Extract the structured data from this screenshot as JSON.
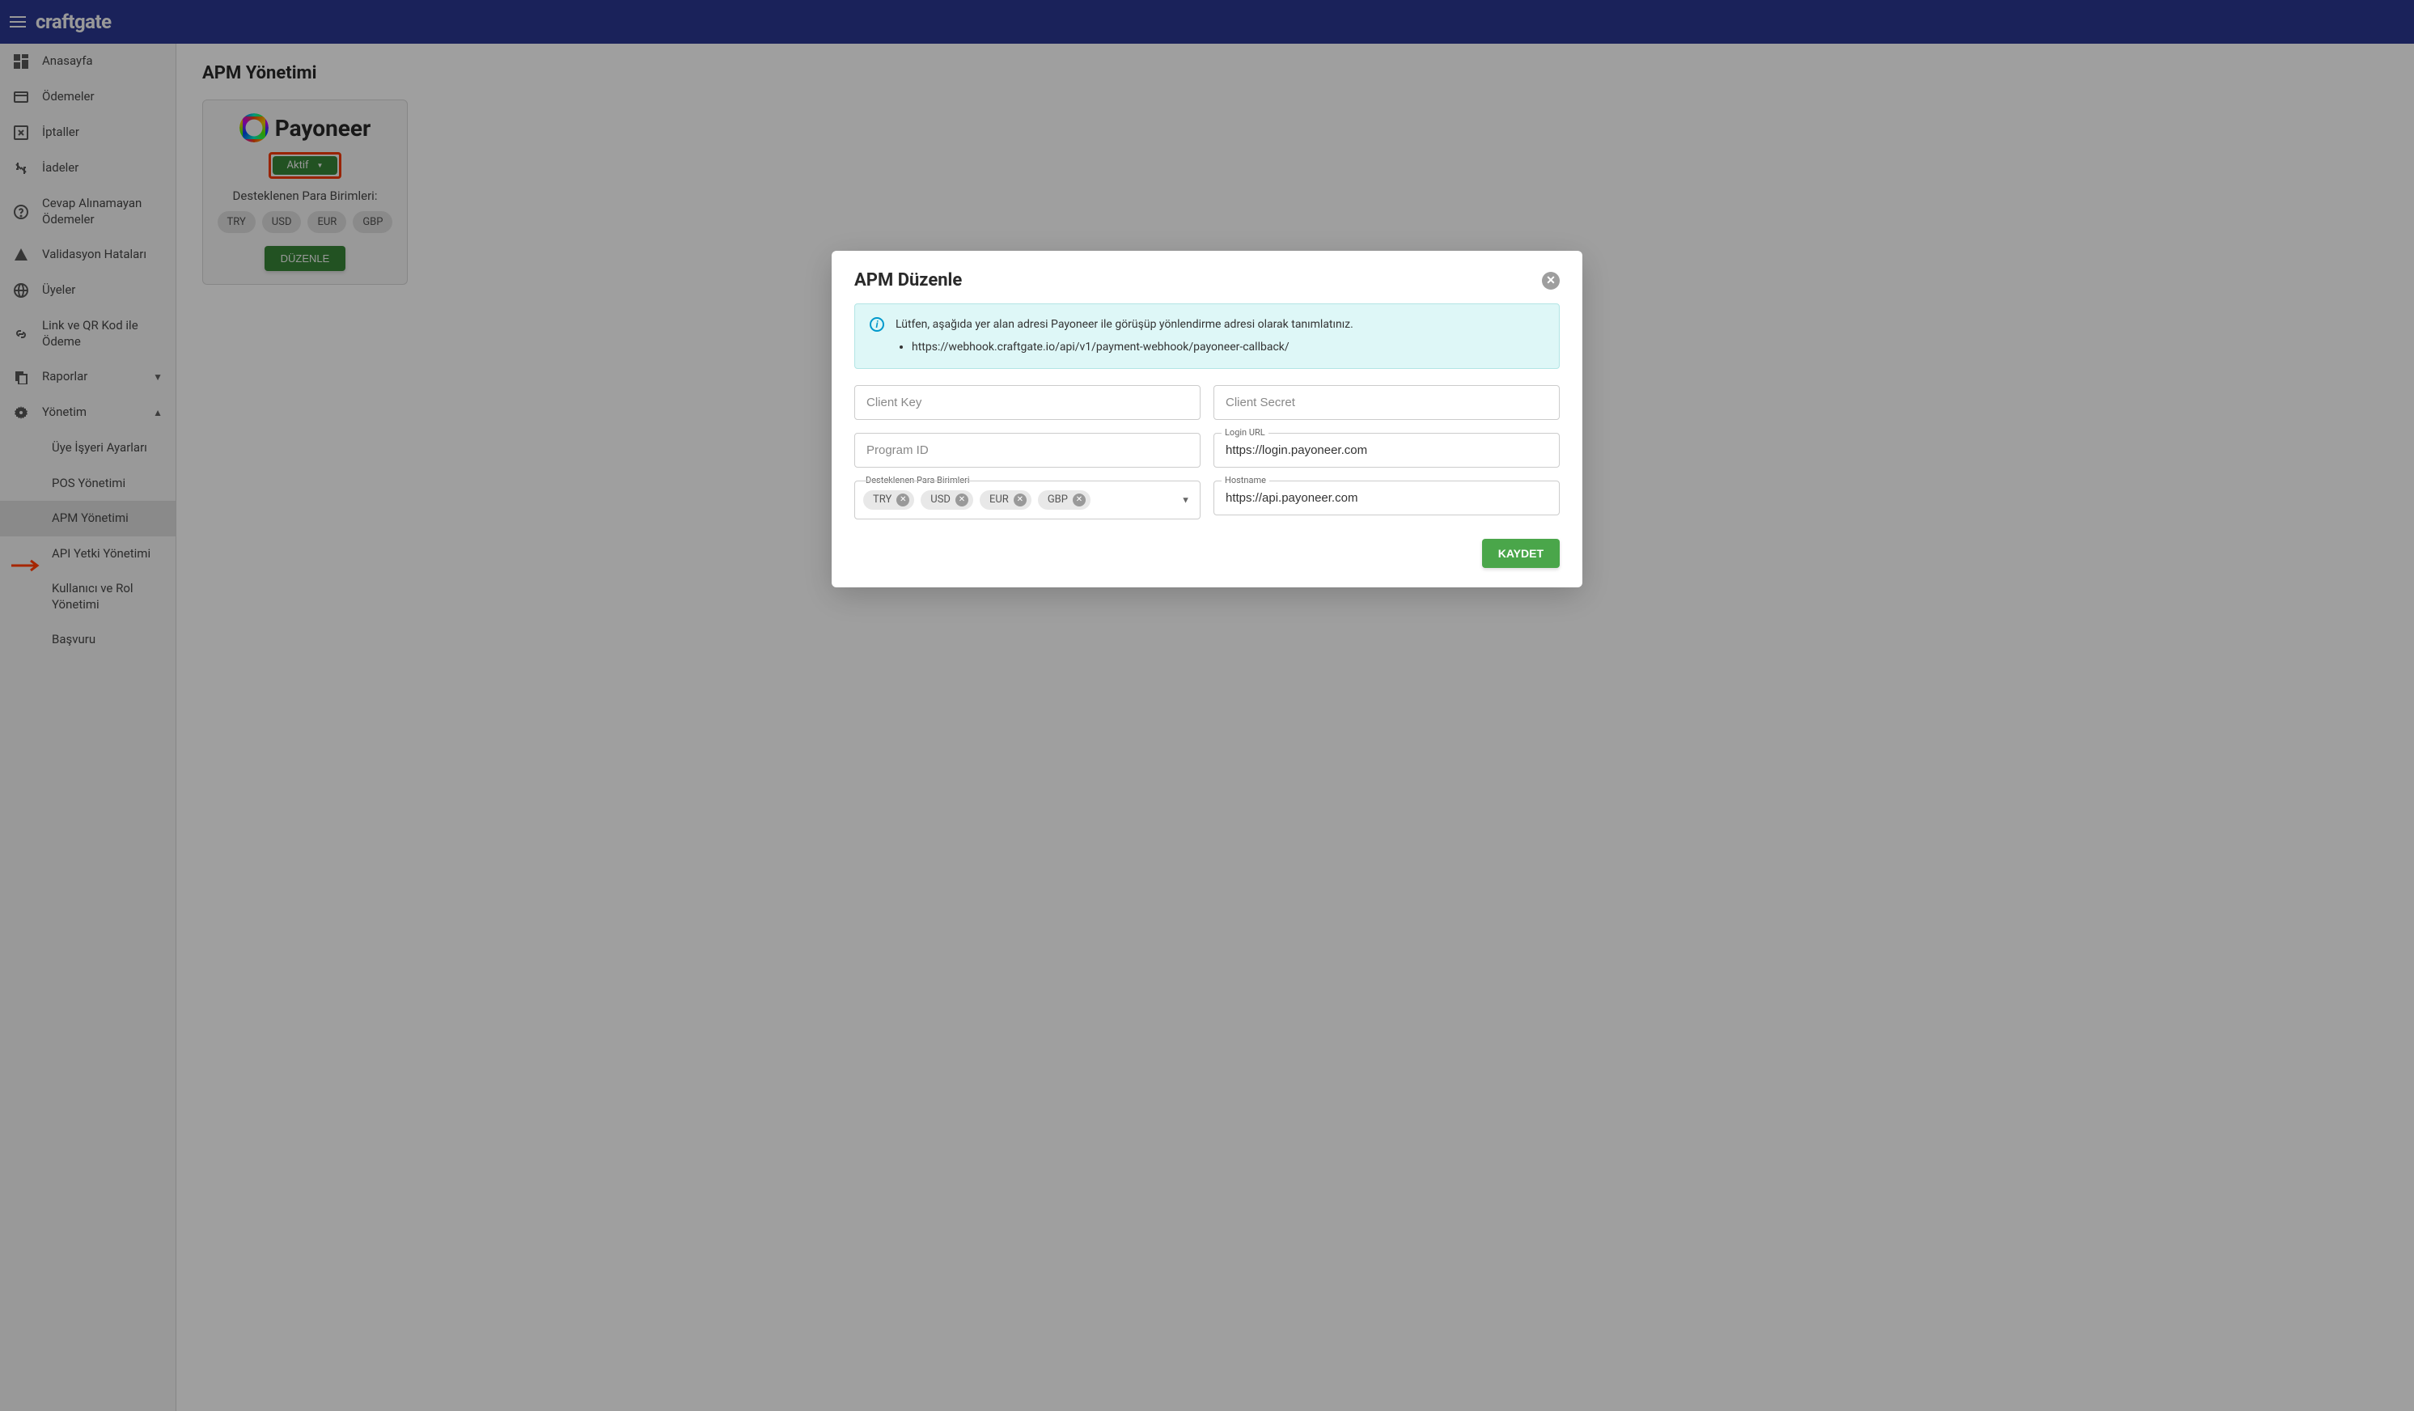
{
  "header": {
    "logo": "craftgate"
  },
  "sidebar": {
    "items": [
      {
        "label": "Anasayfa"
      },
      {
        "label": "Ödemeler"
      },
      {
        "label": "İptaller"
      },
      {
        "label": "İadeler"
      },
      {
        "label": "Cevap Alınamayan Ödemeler"
      },
      {
        "label": "Validasyon Hataları"
      },
      {
        "label": "Üyeler"
      },
      {
        "label": "Link ve QR Kod ile Ödeme"
      },
      {
        "label": "Raporlar"
      },
      {
        "label": "Yönetim"
      }
    ],
    "subitems": [
      {
        "label": "Üye İşyeri Ayarları"
      },
      {
        "label": "POS Yönetimi"
      },
      {
        "label": "APM Yönetimi"
      },
      {
        "label": "API Yetki Yönetimi"
      },
      {
        "label": "Kullanıcı ve Rol Yönetimi"
      },
      {
        "label": "Başvuru"
      }
    ]
  },
  "page": {
    "title": "APM Yönetimi"
  },
  "card": {
    "brand": "Payoneer",
    "status": "Aktif",
    "supported_label": "Desteklenen Para Birimleri:",
    "currencies": [
      "TRY",
      "USD",
      "EUR",
      "GBP"
    ],
    "edit_button": "DÜZENLE"
  },
  "modal": {
    "title": "APM Düzenle",
    "info_text": "Lütfen, aşağıda yer alan adresi Payoneer ile görüşüp yönlendirme adresi olarak tanımlatınız.",
    "info_url": "https://webhook.craftgate.io/api/v1/payment-webhook/payoneer-callback/",
    "fields": {
      "client_key": {
        "placeholder": "Client Key",
        "value": ""
      },
      "client_secret": {
        "placeholder": "Client Secret",
        "value": ""
      },
      "program_id": {
        "placeholder": "Program ID",
        "value": ""
      },
      "login_url": {
        "label": "Login URL",
        "value": "https://login.payoneer.com"
      },
      "currencies_label": "Desteklenen Para Birimleri",
      "currencies": [
        "TRY",
        "USD",
        "EUR",
        "GBP"
      ],
      "hostname": {
        "label": "Hostname",
        "value": "https://api.payoneer.com"
      }
    },
    "save_button": "KAYDET"
  }
}
